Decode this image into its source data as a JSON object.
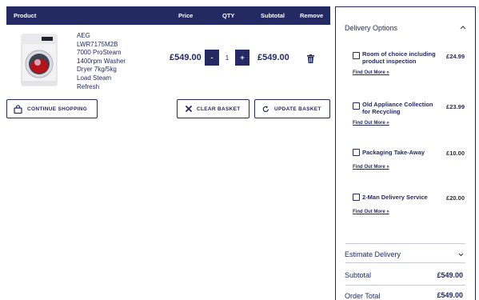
{
  "table": {
    "headers": {
      "product": "Product",
      "price": "Price",
      "qty": "QTY",
      "subtotal": "Subtotal",
      "remove": "Remove"
    },
    "item": {
      "name_lines": [
        "AEG",
        "LWR7175M2B",
        "7000 ProSteam",
        "1400rpm Washer",
        "Dryer 7kg/5kg",
        "Load Steam",
        "Refresh"
      ],
      "price": "£549.00",
      "qty_minus": "-",
      "qty_value": "1",
      "qty_plus": "+",
      "subtotal": "£549.00",
      "remove_icon": "trash-icon"
    }
  },
  "buttons": {
    "continue_shopping": "CONTINUE SHOPPING",
    "clear_basket": "CLEAR BASKET",
    "update_basket": "UPDATE BASKET"
  },
  "delivery": {
    "title": "Delivery Options",
    "options": [
      {
        "label_lines": [
          "Room of choice including",
          "product inspection"
        ],
        "price": "£24.99",
        "link": "Find Out More »",
        "checked": false
      },
      {
        "label_lines": [
          "Old Appliance Collection",
          "for Recycling"
        ],
        "price": "£23.99",
        "link": "Find Out More »",
        "checked": false
      },
      {
        "label_lines": [
          "Packaging Take-Away"
        ],
        "price": "£10.00",
        "link": "Find Out More »",
        "checked": false
      },
      {
        "label_lines": [
          "2-Man Delivery Service"
        ],
        "price": "£20.00",
        "link": "Find Out More »",
        "checked": false
      }
    ],
    "estimate_label": "Estimate Delivery",
    "subtotal_label": "Subtotal",
    "subtotal_value": "£549.00",
    "order_total_label": "Order Total",
    "order_total_value": "£549.00"
  },
  "colors": {
    "brand_navy": "#232a63",
    "divider": "#c9cbd8",
    "product_red": "#b5121b"
  }
}
